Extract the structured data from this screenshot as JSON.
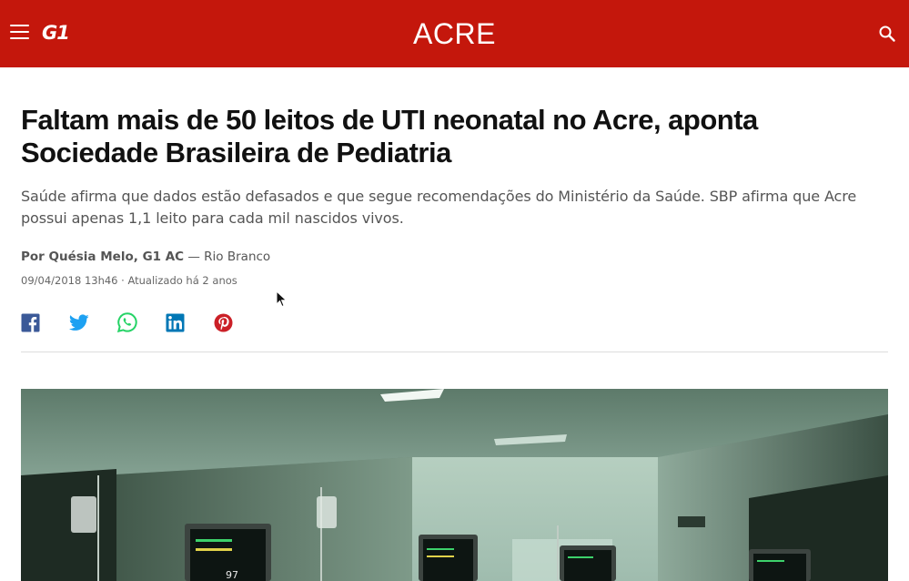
{
  "header": {
    "logo_text": "G1",
    "section": "ACRE",
    "background_color": "#c4170c",
    "icons": {
      "menu": "hamburger-menu-icon",
      "search": "search-icon"
    }
  },
  "article": {
    "headline": "Faltam mais de 50 leitos de UTI neonatal no Acre, aponta Sociedade Brasileira de Pediatria",
    "subtitle": "Saúde afirma que dados estão defasados e que segue recomendações do Ministério da Saúde. SBP afirma que Acre possui apenas 1,1 leito para cada mil nascidos vivos.",
    "author": "Por Quésia Melo, G1 AC",
    "location": " — Rio Branco",
    "dateline": "09/04/2018 13h46 · Atualizado há 2 anos"
  },
  "share": [
    {
      "network": "facebook",
      "icon": "facebook-icon",
      "color": "#3b5998"
    },
    {
      "network": "twitter",
      "icon": "twitter-icon",
      "color": "#1da1f2"
    },
    {
      "network": "whatsapp",
      "icon": "whatsapp-icon",
      "color": "#25d366"
    },
    {
      "network": "linkedin",
      "icon": "linkedin-icon",
      "color": "#0077b5"
    },
    {
      "network": "pinterest",
      "icon": "pinterest-icon",
      "color": "#cb2027"
    }
  ],
  "photo": {
    "monitor_readouts": [
      "97"
    ]
  }
}
